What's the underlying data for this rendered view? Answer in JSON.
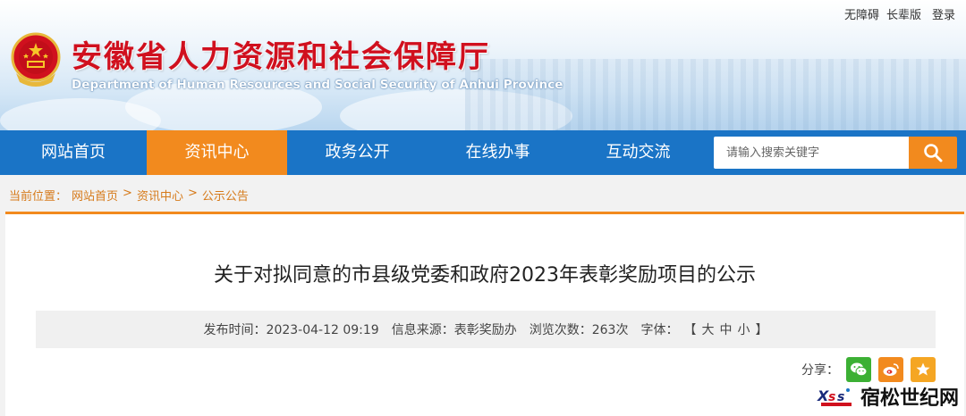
{
  "header": {
    "top_links": [
      "无障碍",
      "长辈版",
      "登录"
    ],
    "title": "安徽省人力资源和社会保障厅",
    "subtitle": "Department of Human Resources and Social Security of Anhui Province"
  },
  "nav": {
    "items": [
      {
        "label": "网站首页",
        "active": false
      },
      {
        "label": "资讯中心",
        "active": true
      },
      {
        "label": "政务公开",
        "active": false
      },
      {
        "label": "在线办事",
        "active": false
      },
      {
        "label": "互动交流",
        "active": false
      }
    ],
    "search_placeholder": "请输入搜索关键字",
    "search_icon": "search-icon"
  },
  "breadcrumb": {
    "prefix": "当前位置：",
    "items": [
      "网站首页",
      "资讯中心",
      "公示公告"
    ],
    "separator": ">"
  },
  "article": {
    "title": "关于对拟同意的市县级党委和政府2023年表彰奖励项目的公示",
    "meta": {
      "publish_time": "发布时间：2023-04-12 09:19",
      "source": "信息来源：表彰奖励办",
      "views": "浏览次数：263次",
      "font_label": "字体：",
      "font_open": "【",
      "font_sizes": [
        "大",
        "中",
        "小"
      ],
      "font_close": "】"
    }
  },
  "share": {
    "label": "分享：",
    "buttons": [
      {
        "name": "wechat-icon",
        "color": "#3cb034"
      },
      {
        "name": "weibo-icon",
        "color": "#f28a1e"
      },
      {
        "name": "favorite-star-icon",
        "color": "#f5a623"
      }
    ]
  },
  "watermark": {
    "text": "宿松世纪网",
    "logo": "Xs"
  },
  "colors": {
    "nav_blue": "#1a74c6",
    "accent_orange": "#f28a1e",
    "title_red": "#d0101e"
  }
}
